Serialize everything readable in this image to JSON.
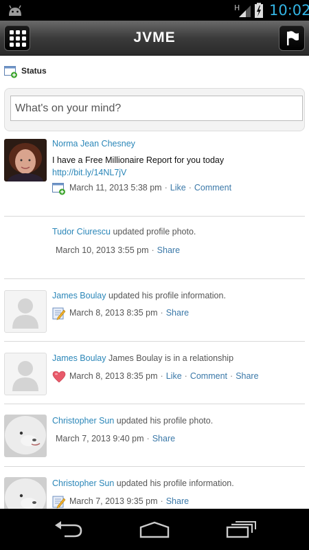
{
  "statusbar": {
    "time": "10:02",
    "network": "H"
  },
  "app": {
    "title": "JVME"
  },
  "status_section": {
    "label": "Status",
    "placeholder": "What's on your mind?"
  },
  "posts": [
    {
      "author": "Norma Jean Chesney",
      "action_text": "",
      "body": "I have a Free Millionaire Report for you today",
      "link": "http://bit.ly/14NL7jV",
      "date": "March 11, 2013 5:38 pm",
      "actions": [
        "Like",
        "Comment"
      ],
      "icon": "status-update-icon",
      "avatar": "woman-photo"
    },
    {
      "author": "Tudor Ciurescu",
      "action_text": " updated profile photo.",
      "date": "March 10, 2013 3:55 pm",
      "actions": [
        "Share"
      ],
      "icon": "",
      "avatar": "none"
    },
    {
      "author": "James Boulay",
      "action_text": " updated his profile information.",
      "date": "March 8, 2013 8:35 pm",
      "actions": [
        "Share"
      ],
      "icon": "edit-profile-icon",
      "avatar": "placeholder"
    },
    {
      "author": "James Boulay",
      "action_text": " James Boulay is in a relationship",
      "date": "March 8, 2013 8:35 pm",
      "actions": [
        "Like",
        "Comment",
        "Share"
      ],
      "icon": "heart-icon",
      "avatar": "placeholder"
    },
    {
      "author": "Christopher Sun",
      "action_text": " updated his profile photo.",
      "date": "March 7, 2013 9:40 pm",
      "actions": [
        "Share"
      ],
      "icon": "",
      "avatar": "dog-photo"
    },
    {
      "author": "Christopher Sun",
      "action_text": " updated his profile information.",
      "date": "March 7, 2013 9:35 pm",
      "actions": [
        "Share"
      ],
      "icon": "edit-profile-icon",
      "avatar": "dog-photo"
    }
  ],
  "colors": {
    "link": "#2a86b8",
    "statusbar_text": "#33b5e5",
    "titlebar": "#3b3b3b"
  }
}
